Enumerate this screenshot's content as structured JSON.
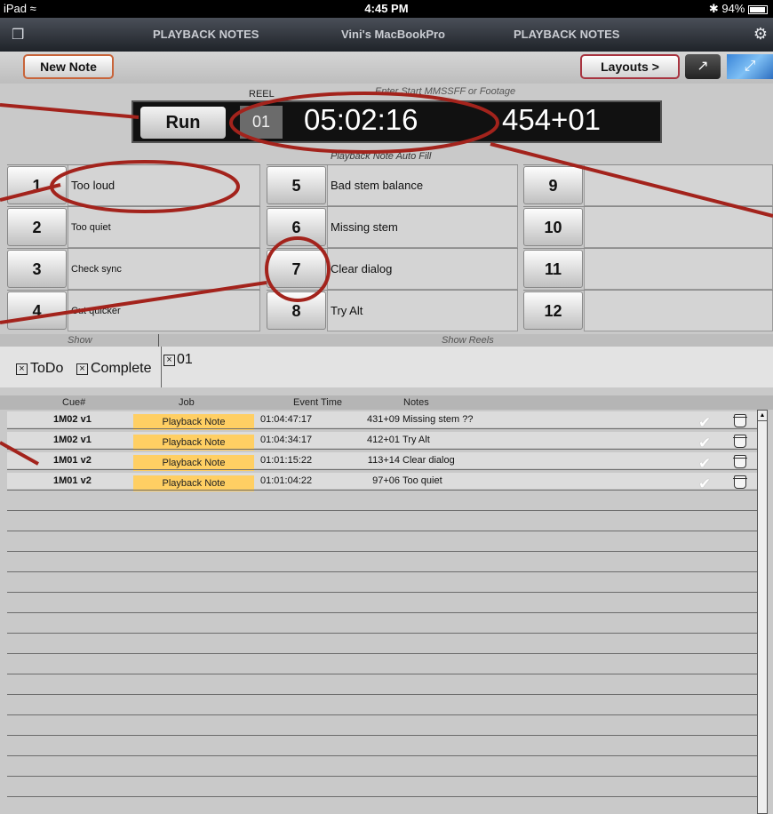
{
  "status_bar": {
    "device": "iPad",
    "time": "4:45 PM",
    "battery": "94%"
  },
  "nav": {
    "tab_left": "PLAYBACK NOTES",
    "device_name": "Vini's MacBookPro",
    "tab_right": "PLAYBACK NOTES"
  },
  "toolbar": {
    "new_note": "New Note",
    "layouts": "Layouts >"
  },
  "timecode": {
    "reel_label": "REEL",
    "entry_hint": "Enter Start MMSSFF or Footage",
    "run_label": "Run",
    "reel": "01",
    "time": "05:02:16",
    "footage": "454+01"
  },
  "autofill_label": "Playback Note Auto Fill",
  "notes": [
    {
      "num": "1",
      "text": "Too loud"
    },
    {
      "num": "2",
      "text": "Too quiet"
    },
    {
      "num": "3",
      "text": "Check sync"
    },
    {
      "num": "4",
      "text": "Cut quicker"
    },
    {
      "num": "5",
      "text": "Bad stem balance"
    },
    {
      "num": "6",
      "text": "Missing stem"
    },
    {
      "num": "7",
      "text": "Clear dialog"
    },
    {
      "num": "8",
      "text": "Try Alt"
    },
    {
      "num": "9",
      "text": ""
    },
    {
      "num": "10",
      "text": ""
    },
    {
      "num": "11",
      "text": ""
    },
    {
      "num": "12",
      "text": ""
    }
  ],
  "show": {
    "show_label": "Show",
    "show_reels_label": "Show Reels",
    "todo": "ToDo",
    "complete": "Complete",
    "reel": "01"
  },
  "table": {
    "headers": {
      "cue": "Cue#",
      "job": "Job",
      "event_time": "Event Time",
      "notes": "Notes"
    },
    "rows": [
      {
        "cue": "1M02 v1",
        "job": "Playback Note",
        "time": "01:04:47:17",
        "feet": "431+09",
        "note": "Missing stem ??"
      },
      {
        "cue": "1M02 v1",
        "job": "Playback Note",
        "time": "01:04:34:17",
        "feet": "412+01",
        "note": "Try Alt"
      },
      {
        "cue": "1M01 v2",
        "job": "Playback Note",
        "time": "01:01:15:22",
        "feet": "113+14",
        "note": "Clear dialog"
      },
      {
        "cue": "1M01 v2",
        "job": "Playback Note",
        "time": "01:01:04:22",
        "feet": "97+06",
        "note": "Too quiet"
      }
    ]
  },
  "colors": {
    "job_fill": "#ffcf63",
    "annotation": "#a3231c",
    "nav_bg": "#2b2f36"
  },
  "icons": [
    "wifi-icon",
    "bluetooth-icon",
    "battery-icon",
    "windows-icon",
    "gear-icon",
    "share-icon",
    "expand-icon",
    "check-icon",
    "trash-icon",
    "scroll-up-icon"
  ]
}
